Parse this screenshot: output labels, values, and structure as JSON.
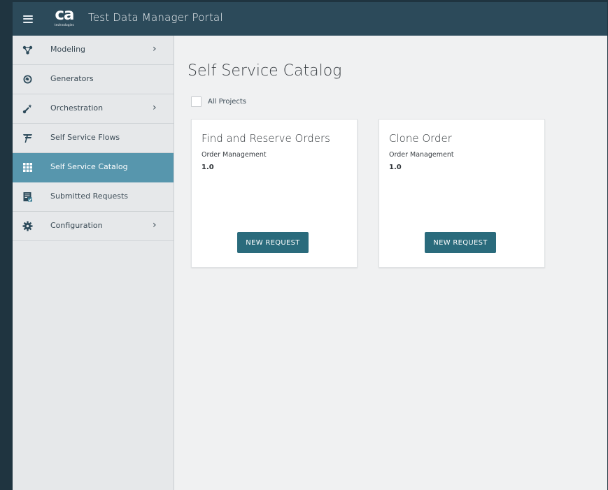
{
  "header": {
    "title": "Test Data Manager Portal",
    "logo_mark": "ca",
    "logo_sub": "technologies"
  },
  "sidebar": {
    "items": [
      {
        "label": "Modeling",
        "icon": "modeling-icon",
        "has_chevron": true,
        "active": false
      },
      {
        "label": "Generators",
        "icon": "generators-icon",
        "has_chevron": false,
        "active": false
      },
      {
        "label": "Orchestration",
        "icon": "orchestration-icon",
        "has_chevron": true,
        "active": false
      },
      {
        "label": "Self Service Flows",
        "icon": "flows-icon",
        "has_chevron": false,
        "active": false
      },
      {
        "label": "Self Service Catalog",
        "icon": "grid-icon",
        "has_chevron": false,
        "active": true
      },
      {
        "label": "Submitted Requests",
        "icon": "requests-icon",
        "has_chevron": false,
        "active": false
      },
      {
        "label": "Configuration",
        "icon": "gear-icon",
        "has_chevron": true,
        "active": false
      }
    ],
    "chevron": "›"
  },
  "main": {
    "title": "Self Service Catalog",
    "filter_label": "All Projects",
    "filter_checked": false,
    "cards": [
      {
        "title": "Find and Reserve Orders",
        "project": "Order Management",
        "version": "1.0",
        "button": "NEW REQUEST"
      },
      {
        "title": "Clone Order",
        "project": "Order Management",
        "version": "1.0",
        "button": "NEW REQUEST"
      }
    ]
  },
  "colors": {
    "topbar": "#2c4a5a",
    "active_nav": "#5796ad",
    "button": "#2a6b7c",
    "icon": "#2c4a5a"
  }
}
